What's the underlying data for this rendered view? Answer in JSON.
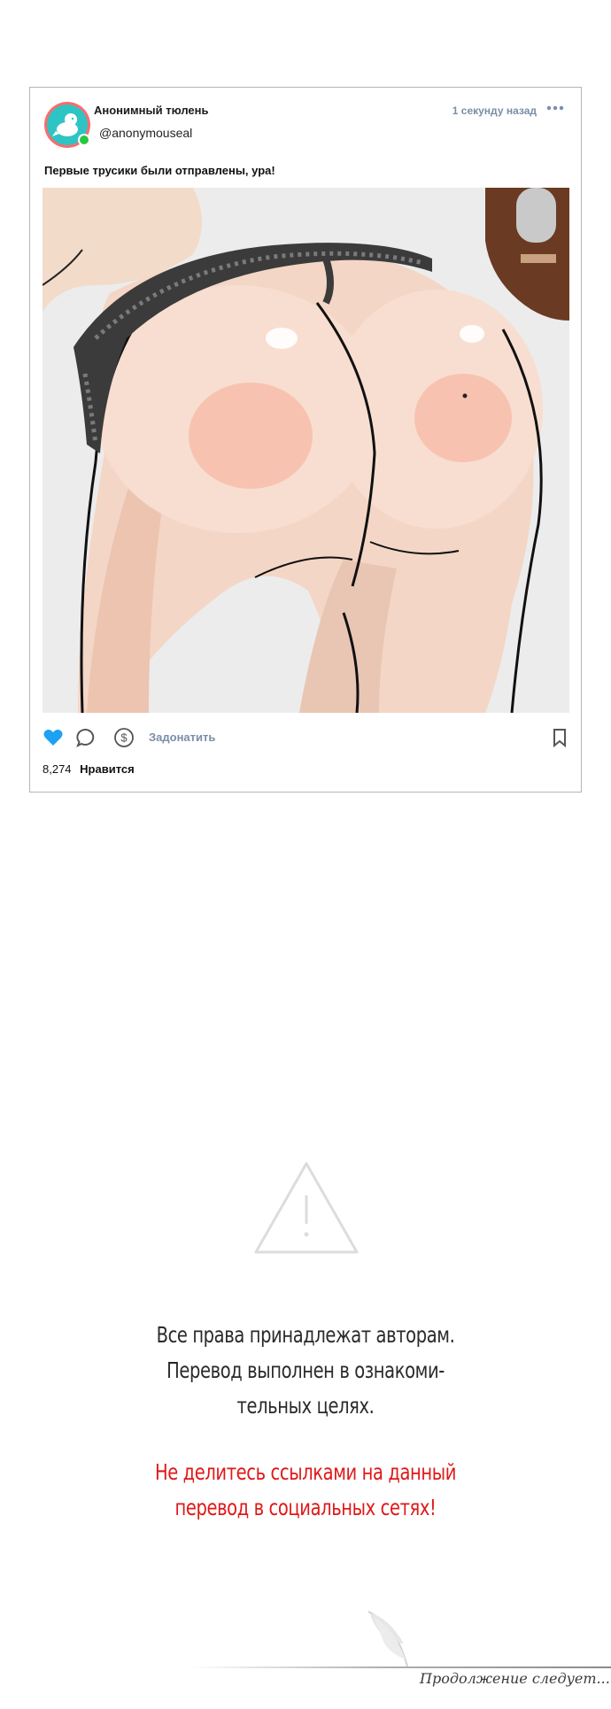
{
  "post": {
    "display_name": "Анонимный тюлень",
    "handle": "@anonymouseal",
    "timestamp": "1 секунду назад",
    "caption": "Первые трусики были отправлены, ура!",
    "image_icon": "illustration-image",
    "actions": {
      "like_icon": "heart-icon",
      "comment_icon": "comment-icon",
      "donate_icon": "dollar-icon",
      "donate_label": "Задонатить",
      "bookmark_icon": "bookmark-icon",
      "more_icon": "more-dots-icon"
    },
    "likes_count": "8,274",
    "likes_label": "Нравится",
    "colors": {
      "accent": "#7a8ea8",
      "like": "#1da1f2",
      "avatar_ring": "#ff6b6b",
      "avatar_bg": "#2ec4c4",
      "status": "#27c93f"
    }
  },
  "notice": {
    "icon": "warning-triangle-icon",
    "line1": "Все права принадлежат авторам.",
    "line2": "Перевод выполнен в ознакоми-",
    "line3": "тельных целях.",
    "warn_line1": "Не делитесь ссылками на данный",
    "warn_line2": "перевод в социальных сетях!",
    "warn_color": "#e01818"
  },
  "footer": {
    "continued": "Продолжение следует..."
  }
}
